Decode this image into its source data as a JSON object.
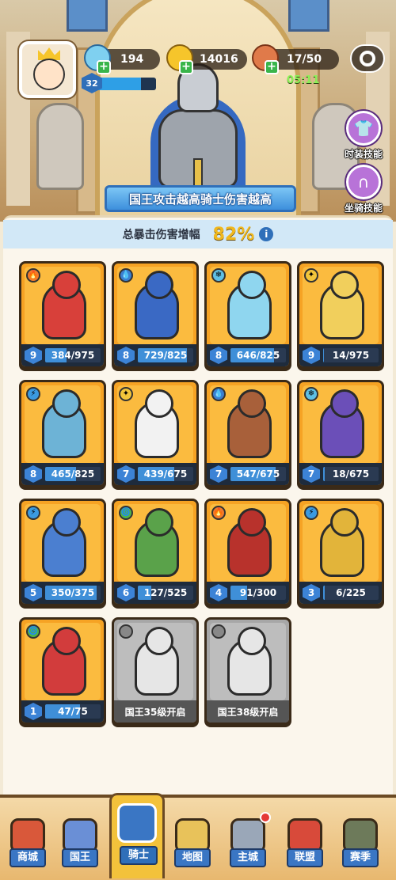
{
  "player": {
    "level": "32",
    "level_progress": 0.75
  },
  "resources": {
    "gems": "194",
    "gold": "14016",
    "stamina": "17/50",
    "stamina_timer": "05:11"
  },
  "side_buttons": [
    {
      "label": "时装技能",
      "icon": "shirt-icon"
    },
    {
      "label": "坐骑技能",
      "icon": "horseshoe-icon"
    }
  ],
  "banner": "国王攻击越高骑士伤害越高",
  "crit": {
    "label": "总暴击伤害增幅",
    "value": "82%"
  },
  "colors": {
    "card_orange": "#f6a324",
    "card_locked": "#a7a7a7",
    "progress_blue": "#3f8fd8",
    "accent_blue": "#2f6fb9"
  },
  "cards": [
    {
      "element": "fire",
      "level": "9",
      "progress": "384/975",
      "figure_color": "#d8403a"
    },
    {
      "element": "water",
      "level": "8",
      "progress": "729/825",
      "figure_color": "#3a69c4"
    },
    {
      "element": "ice",
      "level": "8",
      "progress": "646/825",
      "figure_color": "#8fd6ef"
    },
    {
      "element": "holy",
      "level": "9",
      "progress": "14/975",
      "figure_color": "#f1cf5c"
    },
    {
      "element": "lightning",
      "level": "8",
      "progress": "465/825",
      "figure_color": "#6db3d6"
    },
    {
      "element": "holy",
      "level": "7",
      "progress": "439/675",
      "figure_color": "#f2f2f2"
    },
    {
      "element": "water",
      "level": "7",
      "progress": "547/675",
      "figure_color": "#a8603a"
    },
    {
      "element": "ice",
      "level": "7",
      "progress": "18/675",
      "figure_color": "#6b4fb8"
    },
    {
      "element": "lightning",
      "level": "5",
      "progress": "350/375",
      "figure_color": "#4b7fd0"
    },
    {
      "element": "wind",
      "level": "6",
      "progress": "127/525",
      "figure_color": "#5aa24a"
    },
    {
      "element": "fire",
      "level": "4",
      "progress": "91/300",
      "figure_color": "#b8322c"
    },
    {
      "element": "lightning",
      "level": "3",
      "progress": "6/225",
      "figure_color": "#e2b43a"
    },
    {
      "element": "wind",
      "level": "1",
      "progress": "47/75",
      "figure_color": "#d23c3c"
    }
  ],
  "progress_fractions": [
    0.39,
    0.88,
    0.78,
    0.01,
    0.56,
    0.65,
    0.81,
    0.03,
    0.93,
    0.24,
    0.3,
    0.03,
    0.63
  ],
  "locked_cards": [
    {
      "unlock_text": "国王35级开启"
    },
    {
      "unlock_text": "国王38级开启"
    }
  ],
  "nav": [
    "商城",
    "国王",
    "骑士",
    "地图",
    "主城",
    "联盟",
    "赛季"
  ]
}
